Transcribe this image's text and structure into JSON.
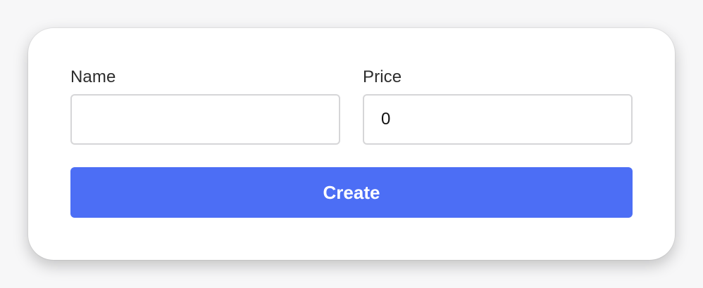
{
  "form": {
    "name_label": "Name",
    "name_value": "",
    "price_label": "Price",
    "price_value": "0",
    "create_label": "Create"
  },
  "colors": {
    "accent": "#4c6ef5",
    "input_border": "#d6d6d8"
  }
}
